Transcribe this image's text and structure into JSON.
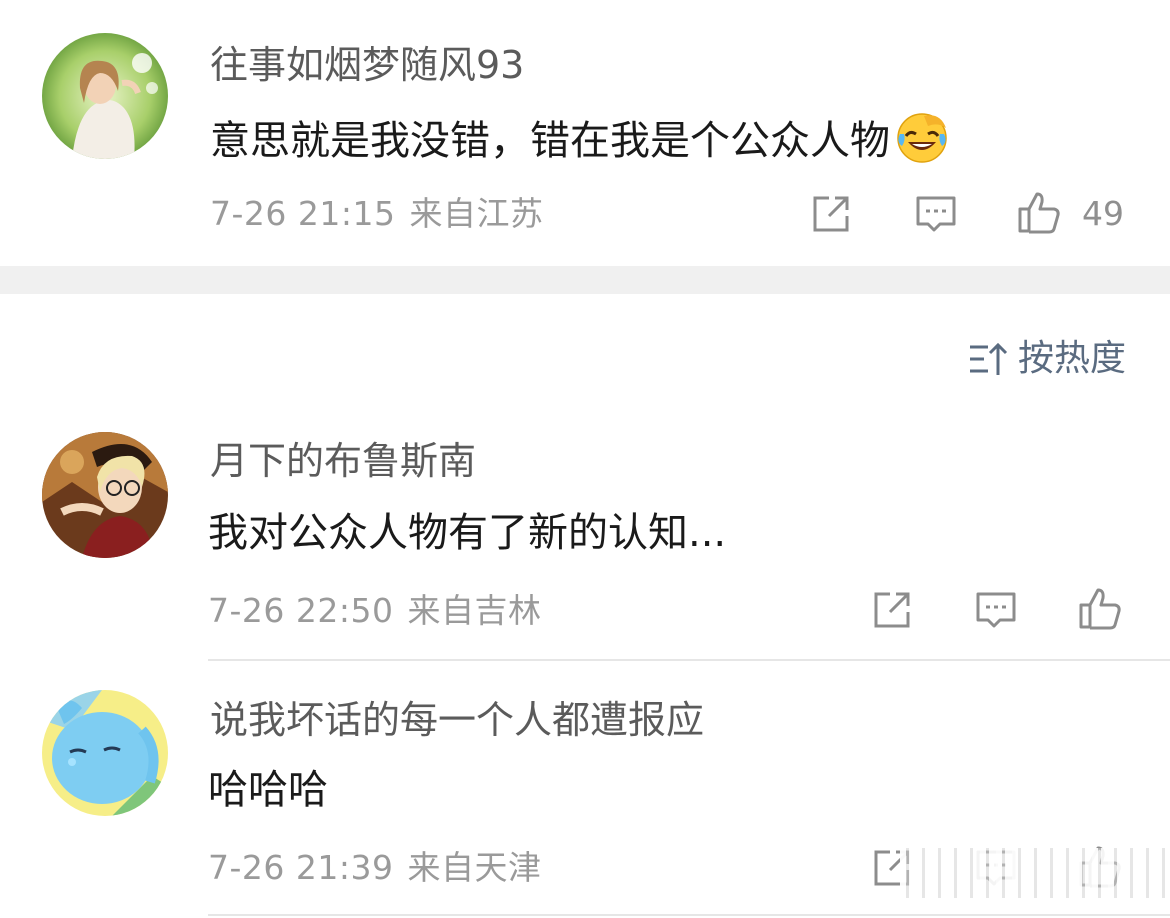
{
  "comments": [
    {
      "username": "往事如烟梦随风93",
      "text": "意思就是我没错，错在我是个公众人物",
      "emoji": "laughing-crying-emoji",
      "date": "7-26 21:15",
      "location": "来自江苏",
      "likes": "49"
    },
    {
      "username": "月下的布鲁斯南",
      "text": "我对公众人物有了新的认知...",
      "date": "7-26 22:50",
      "location": "来自吉林",
      "likes": ""
    },
    {
      "username": "说我坏话的每一个人都遭报应",
      "text": "哈哈哈",
      "date": "7-26 21:39",
      "location": "来自天津",
      "likes": ""
    }
  ],
  "sort": {
    "label": "按热度",
    "icon": "sort-icon"
  },
  "icons": {
    "share": "share-icon",
    "comment": "comment-icon",
    "like": "thumbs-up-icon"
  },
  "colors": {
    "username": "#5b5b5b",
    "content": "#1a1a1a",
    "meta": "#9a9a9a",
    "sort": "#5a6b80",
    "section_gap": "#f0f0f0"
  }
}
